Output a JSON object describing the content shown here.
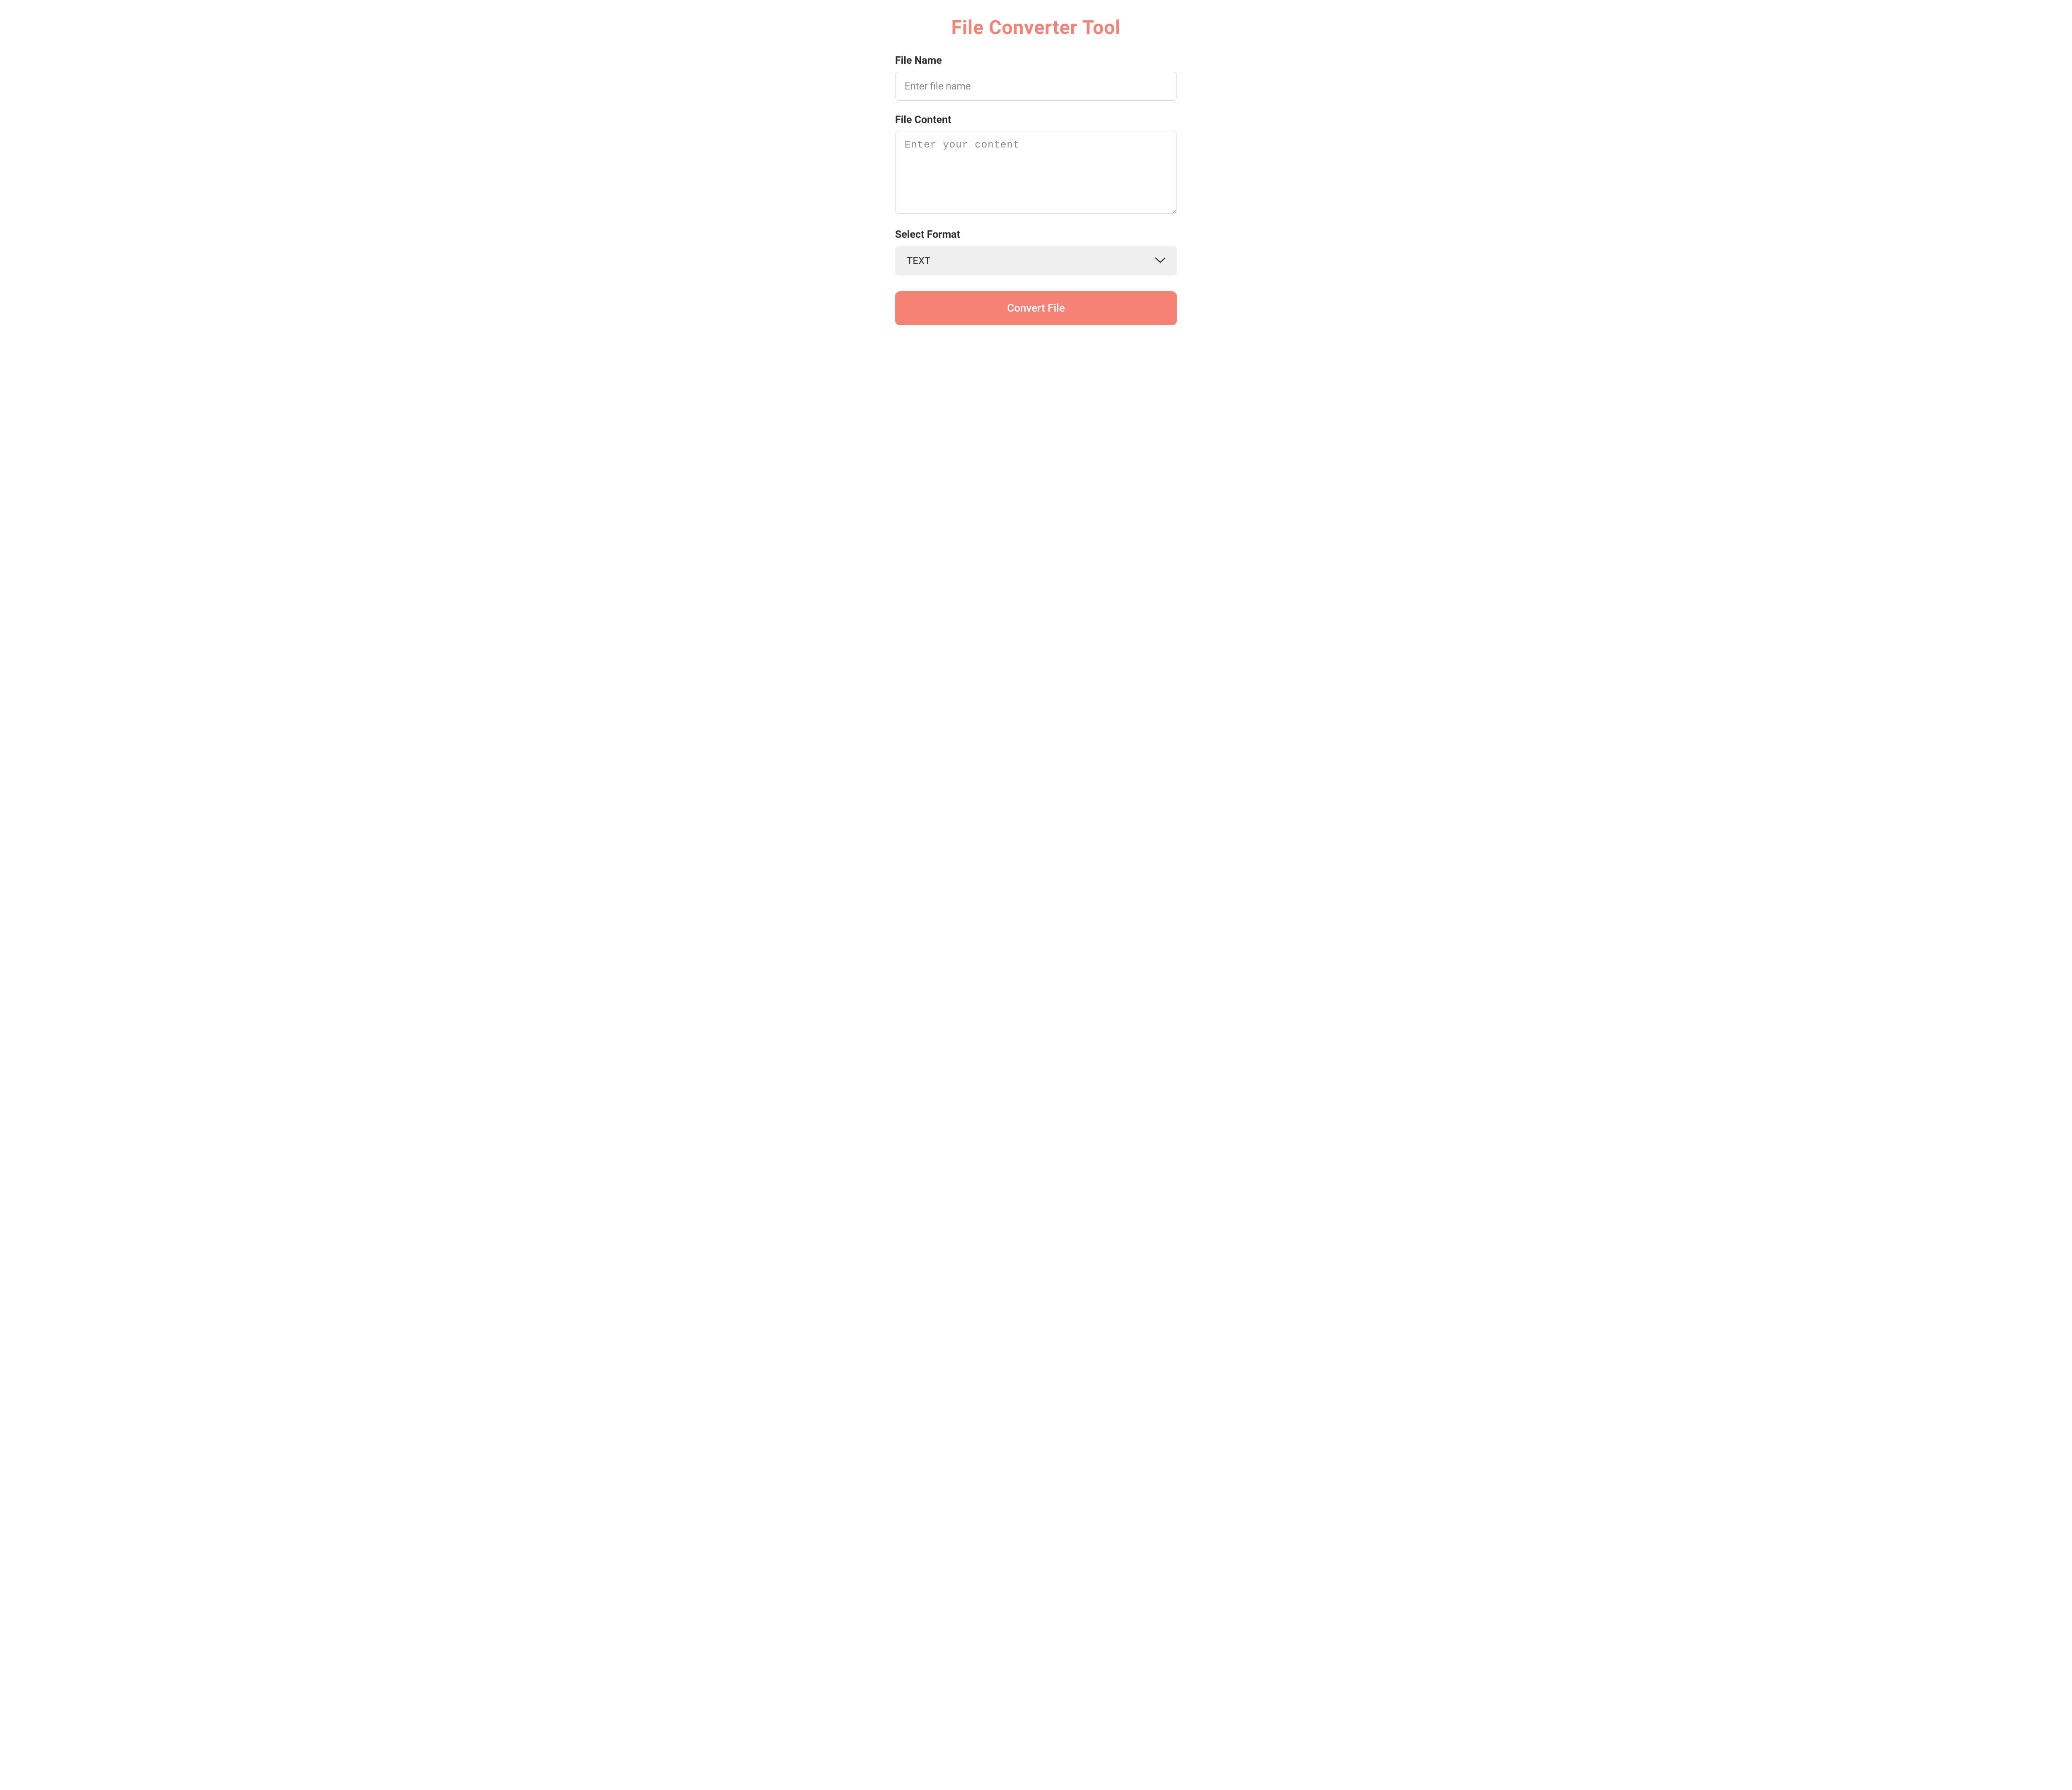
{
  "title": "File Converter Tool",
  "fileName": {
    "label": "File Name",
    "placeholder": "Enter file name",
    "value": ""
  },
  "fileContent": {
    "label": "File Content",
    "placeholder": "Enter your content",
    "value": ""
  },
  "selectFormat": {
    "label": "Select Format",
    "selected": "TEXT"
  },
  "convertButton": {
    "label": "Convert File"
  },
  "colors": {
    "accent": "#f48275",
    "labelText": "#2d2d2d",
    "placeholder": "#8a8a8a",
    "selectBg": "#efefef",
    "inputBorder": "#d8d8d8"
  }
}
